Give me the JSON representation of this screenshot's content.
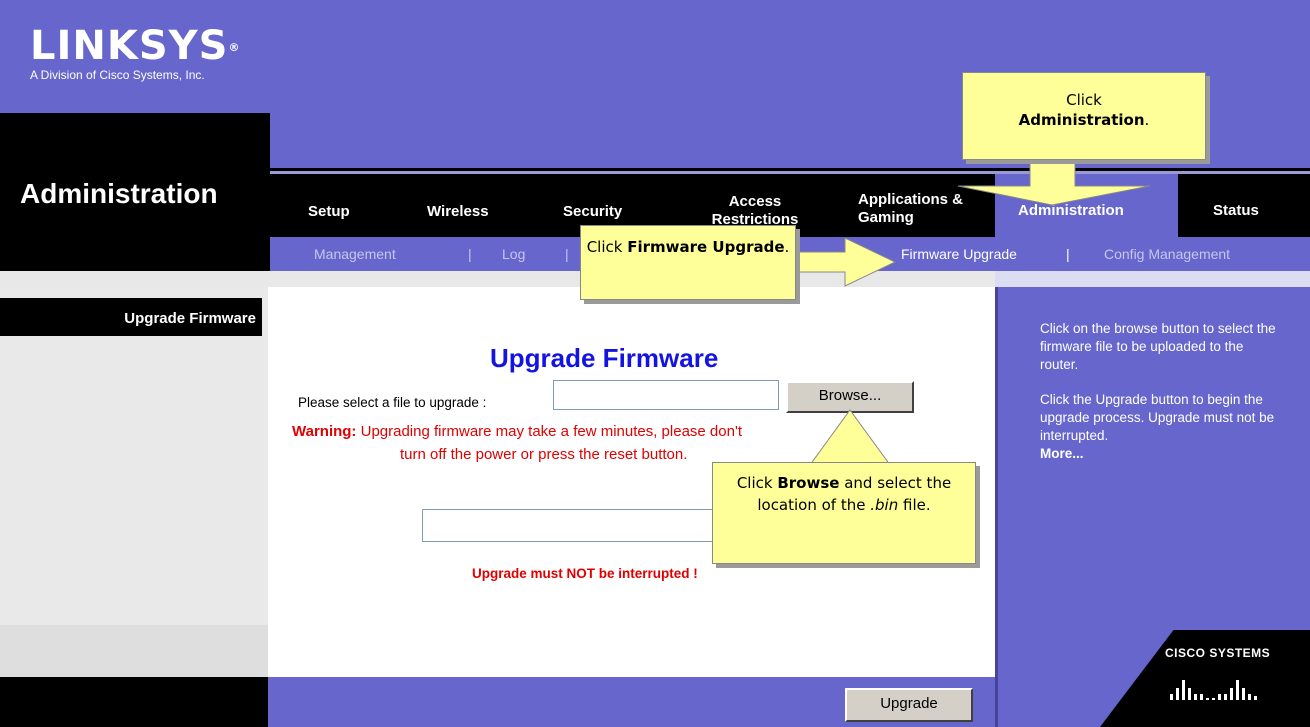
{
  "header": {
    "logo_word": "LINKSYS",
    "logo_reg": "®",
    "logo_sub": "A Division of Cisco Systems, Inc.",
    "section_title": "Administration"
  },
  "nav": {
    "tabs": [
      {
        "label": "Setup"
      },
      {
        "label": "Wireless"
      },
      {
        "label": "Security"
      },
      {
        "label": "Access Restrictions"
      },
      {
        "label": "Applications & Gaming"
      },
      {
        "label": "Administration",
        "active": true
      },
      {
        "label": "Status"
      }
    ],
    "subtabs": [
      {
        "label": "Management"
      },
      {
        "label": "Log"
      },
      {
        "label": "Firmware Upgrade",
        "active": true
      },
      {
        "label": "Config Management"
      }
    ]
  },
  "sidebar": {
    "heading": "Upgrade Firmware"
  },
  "main": {
    "title": "Upgrade Firmware",
    "file_label": "Please select a file to upgrade :",
    "file_value": "",
    "browse_label": "Browse...",
    "warning_prefix": "Warning:",
    "warning_line1": "Upgrading firmware may take a few minutes, please don't",
    "warning_line2": "turn off the power or press the reset button.",
    "progress_value": "",
    "no_interrupt": "Upgrade must NOT be interrupted !",
    "upgrade_label": "Upgrade"
  },
  "help": {
    "p1": "Click on the browse button to select the firmware file to be uploaded to the router.",
    "p2": "Click the Upgrade button to begin the upgrade process. Upgrade must not be interrupted.",
    "more": "More..."
  },
  "brand": {
    "cisco": "Cisco Systems"
  },
  "callouts": {
    "admin_pre": "Click",
    "admin_bold": "Administration",
    "admin_post": ".",
    "fw_pre": "Click",
    "fw_bold": "Firmware Upgrade",
    "fw_post": ".",
    "browse_pre": "Click",
    "browse_bold": "Browse",
    "browse_mid": "and select the location of the",
    "browse_italic": ".bin",
    "browse_post": "file."
  },
  "colors": {
    "brand_purple": "#6666cc",
    "title_blue": "#1414e0",
    "warning_red": "#e00000",
    "callout_yellow": "#ffff99"
  }
}
